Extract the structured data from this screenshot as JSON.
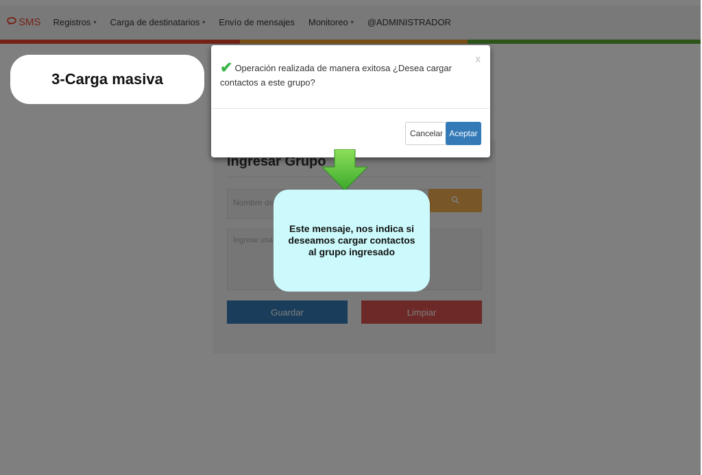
{
  "navbar": {
    "brand": "SMS",
    "items": [
      {
        "label": "Registros",
        "dropdown": true
      },
      {
        "label": "Carga de destinatarios",
        "dropdown": true
      },
      {
        "label": "Envío de mensajes",
        "dropdown": false
      },
      {
        "label": "Monitoreo",
        "dropdown": true
      },
      {
        "label": "@ADMINISTRADOR",
        "dropdown": false
      }
    ],
    "colorbar": [
      "#e8462c",
      "#f0a030",
      "#5aa832"
    ]
  },
  "tutorial": {
    "step_label": "3-Carga masiva",
    "callout_text": "Este mensaje, nos indica si deseamos cargar contactos al grupo ingresado"
  },
  "modal": {
    "close": "x",
    "message": "Operación realizada de manera exitosa ¿Desea cargar contactos a este grupo?",
    "cancel_label": "Cancelar",
    "accept_label": "Aceptar"
  },
  "form": {
    "title": "Ingresar Grupo",
    "name_placeholder": "Nombre del g",
    "description_placeholder": "Ingrese una p",
    "save_label": "Guardar",
    "clear_label": "Limpiar"
  },
  "colors": {
    "primary": "#337ab7",
    "warning": "#f0ad4e",
    "danger": "#d9534f",
    "success_check": "#3bb54a",
    "callout_bg": "#ccfafc"
  }
}
